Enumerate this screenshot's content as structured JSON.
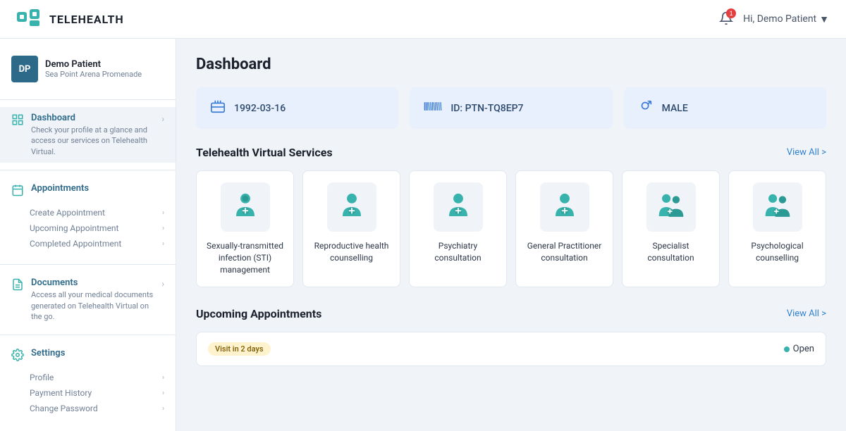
{
  "header": {
    "logo_text": "TELEHEALTH",
    "notification_count": "1",
    "greeting": "Hi, Demo Patient"
  },
  "sidebar": {
    "user": {
      "initials": "DP",
      "name": "Demo Patient",
      "location": "Sea Point Arena Promenade"
    },
    "nav": [
      {
        "id": "dashboard",
        "icon": "grid",
        "label": "Dashboard",
        "sub_text": "Check your profile at a glance and access our services on Telehealth Virtual.",
        "active": true
      },
      {
        "id": "appointments",
        "icon": "calendar",
        "label": "Appointments",
        "sub_items": [
          "Create Appointment",
          "Upcoming Appointment",
          "Completed Appointment"
        ]
      },
      {
        "id": "documents",
        "icon": "document",
        "label": "Documents",
        "sub_text": "Access all your medical documents generated on Telehealth Virtual on the go."
      },
      {
        "id": "settings",
        "icon": "gear",
        "label": "Settings",
        "sub_items": [
          "Profile",
          "Payment History",
          "Change Password"
        ]
      }
    ]
  },
  "main": {
    "page_title": "Dashboard",
    "info_cards": [
      {
        "icon": "birthday",
        "text": "1992-03-16"
      },
      {
        "icon": "barcode",
        "text": "ID: PTN-TQ8EP7"
      },
      {
        "icon": "gender",
        "text": "MALE"
      }
    ],
    "services_section": {
      "title": "Telehealth Virtual Services",
      "view_all": "View All >",
      "services": [
        {
          "label": "Sexually-transmitted infection (STI) management"
        },
        {
          "label": "Reproductive health counselling"
        },
        {
          "label": "Psychiatry consultation"
        },
        {
          "label": "General Practitioner consultation"
        },
        {
          "label": "Specialist consultation"
        },
        {
          "label": "Psychological counselling"
        }
      ]
    },
    "appointments_section": {
      "title": "Upcoming Appointments",
      "view_all": "View All >",
      "appointment": {
        "badge": "Visit in 2 days",
        "status": "Open"
      }
    }
  }
}
